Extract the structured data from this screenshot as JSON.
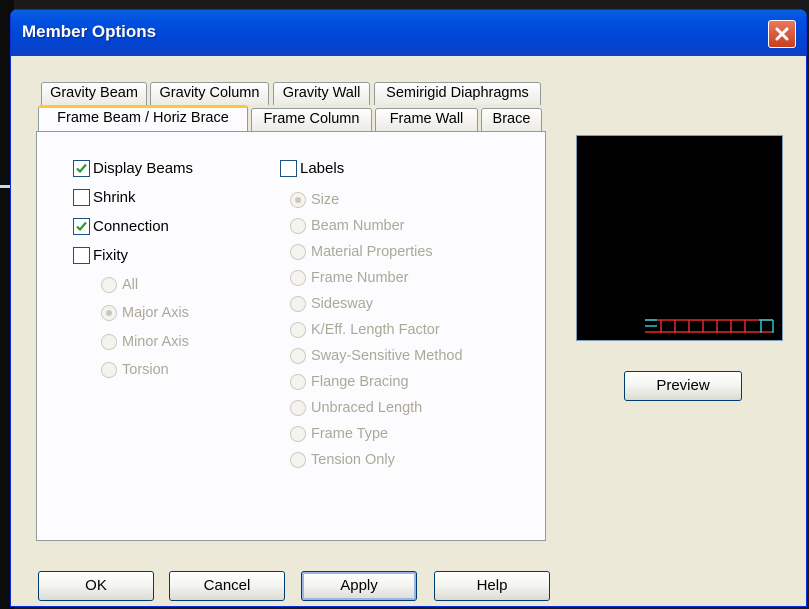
{
  "dialog": {
    "title": "Member Options"
  },
  "tabs": {
    "row_back": [
      "Gravity Beam",
      "Gravity Column",
      "Gravity Wall",
      "Semirigid Diaphragms"
    ],
    "row_front": [
      "Frame Beam / Horiz Brace",
      "Frame Column",
      "Frame Wall",
      "Brace"
    ],
    "active": "Frame Beam / Horiz Brace"
  },
  "checkboxes": {
    "display_beams": {
      "label": "Display Beams",
      "checked": true
    },
    "shrink": {
      "label": "Shrink",
      "checked": false
    },
    "connection": {
      "label": "Connection",
      "checked": true
    },
    "fixity": {
      "label": "Fixity",
      "checked": false
    },
    "labels": {
      "label": "Labels",
      "checked": false
    }
  },
  "fixity_options": [
    "All",
    "Major Axis",
    "Minor Axis",
    "Torsion"
  ],
  "fixity_selected": "Major Axis",
  "label_options": [
    "Size",
    "Beam Number",
    "Material Properties",
    "Frame Number",
    "Sidesway",
    "K/Eff. Length Factor",
    "Sway-Sensitive Method",
    "Flange Bracing",
    "Unbraced Length",
    "Frame Type",
    "Tension Only"
  ],
  "label_selected": "Size",
  "buttons": {
    "preview": "Preview",
    "ok": "OK",
    "cancel": "Cancel",
    "apply": "Apply",
    "help": "Help"
  },
  "colors": {
    "titlebar": "#0050e0",
    "preview_bg": "#000000",
    "preview_red": "#e0282e",
    "preview_cyan": "#28c8d0"
  }
}
